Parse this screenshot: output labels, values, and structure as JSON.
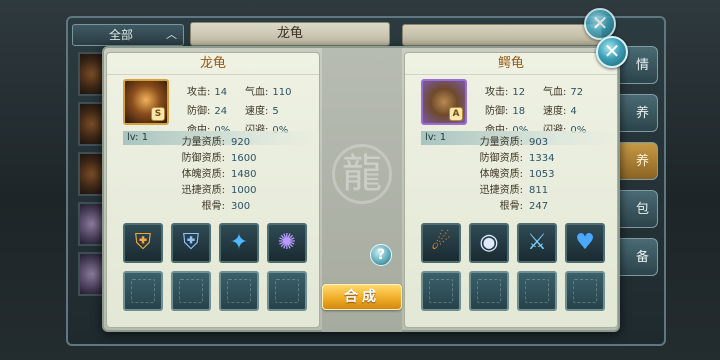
{
  "background": {
    "filter_label": "全部",
    "header_left": "龙龟",
    "side_tabs": [
      "情",
      "养",
      "养",
      "包",
      "备"
    ]
  },
  "dialog": {
    "left": {
      "title": "龙龟",
      "grade": "S",
      "level": "lv: 1",
      "stats": [
        {
          "k": "攻击:",
          "v": "14"
        },
        {
          "k": "气血:",
          "v": "110"
        },
        {
          "k": "防御:",
          "v": "24"
        },
        {
          "k": "速度:",
          "v": "5"
        },
        {
          "k": "命中:",
          "v": "0%"
        },
        {
          "k": "闪避:",
          "v": "0%"
        }
      ],
      "aptitudes": [
        {
          "k": "力量资质:",
          "v": "920"
        },
        {
          "k": "防御资质:",
          "v": "1600"
        },
        {
          "k": "体魄资质:",
          "v": "1480"
        },
        {
          "k": "迅捷资质:",
          "v": "1000"
        },
        {
          "k": "根骨:",
          "v": "300"
        }
      ],
      "skills": [
        {
          "icon": "shield-fire-icon",
          "glyph": "⛨"
        },
        {
          "icon": "shield-blue-icon",
          "glyph": "⛨"
        },
        {
          "icon": "blue-beast-icon",
          "glyph": "✦"
        },
        {
          "icon": "purple-orb-icon",
          "glyph": "✺"
        }
      ]
    },
    "right": {
      "title": "鳄龟",
      "grade": "A",
      "level": "lv: 1",
      "stats": [
        {
          "k": "攻击:",
          "v": "12"
        },
        {
          "k": "气血:",
          "v": "72"
        },
        {
          "k": "防御:",
          "v": "18"
        },
        {
          "k": "速度:",
          "v": "4"
        },
        {
          "k": "命中:",
          "v": "0%"
        },
        {
          "k": "闪避:",
          "v": "0%"
        }
      ],
      "aptitudes": [
        {
          "k": "力量资质:",
          "v": "903"
        },
        {
          "k": "防御资质:",
          "v": "1334"
        },
        {
          "k": "体魄资质:",
          "v": "1053"
        },
        {
          "k": "迅捷资质:",
          "v": "811"
        },
        {
          "k": "根骨:",
          "v": "247"
        }
      ],
      "skills": [
        {
          "icon": "fire-beast-icon",
          "glyph": "☄"
        },
        {
          "icon": "white-orb-icon",
          "glyph": "◉"
        },
        {
          "icon": "blue-sword-icon",
          "glyph": "⚔"
        },
        {
          "icon": "blue-heart-icon",
          "glyph": "♥"
        }
      ]
    },
    "synthesize_label": "合成",
    "help_label": "?"
  },
  "close_label": "✕",
  "colors": {
    "panel_bg": "#eff2e3",
    "title_orange": "#9a5a1b",
    "value_blue": "#2c5266",
    "synth_gold": "#f0ad28",
    "accent_teal": "#3ba0b7"
  }
}
